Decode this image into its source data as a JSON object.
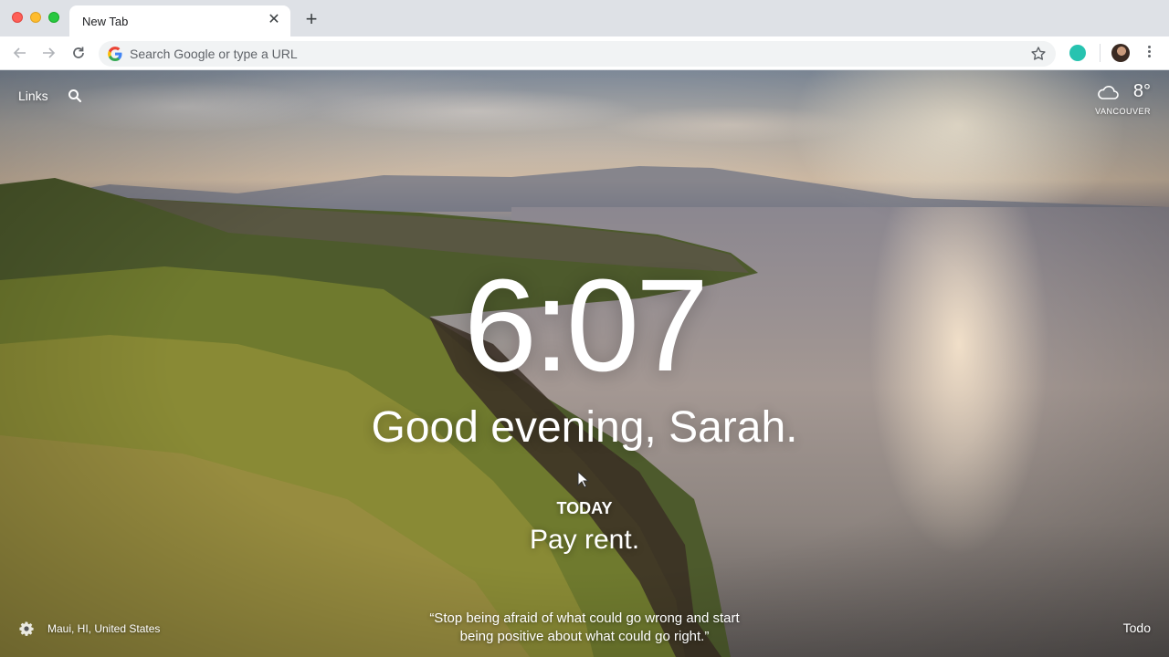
{
  "browser": {
    "tab_title": "New Tab",
    "omnibox_placeholder": "Search Google or type a URL",
    "extension_color": "#27c3b0"
  },
  "dashboard": {
    "links_label": "Links",
    "weather": {
      "temperature": "8°",
      "city": "VANCOUVER",
      "icon": "cloud-icon"
    },
    "time": "6:07",
    "greeting": "Good evening, Sarah.",
    "focus": {
      "label": "TODAY",
      "text": "Pay rent."
    },
    "photo_location": "Maui, HI, United States",
    "quote_line1": "“Stop being afraid of what could go wrong and start",
    "quote_line2": "being positive about what could go right.”",
    "todo_label": "Todo"
  }
}
